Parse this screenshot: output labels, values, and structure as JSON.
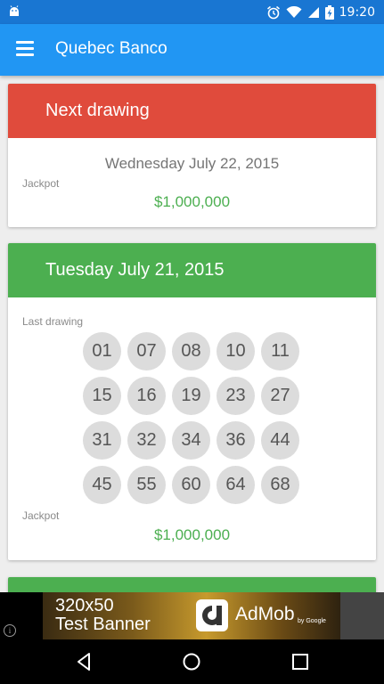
{
  "status_bar": {
    "time": "19:20",
    "icons": [
      "android-debug-icon",
      "alarm-icon",
      "wifi-icon",
      "cell-signal-icon",
      "battery-charging-icon"
    ]
  },
  "app_bar": {
    "title": "Quebec Banco",
    "menu_icon": "hamburger-menu-icon",
    "color": "#2196f3"
  },
  "next_drawing": {
    "header": "Next drawing",
    "header_color": "#e04b3c",
    "date": "Wednesday July 22, 2015",
    "jackpot_label": "Jackpot",
    "jackpot_value": "$1,000,000"
  },
  "last_drawing": {
    "header": "Tuesday July 21, 2015",
    "header_color": "#4caf50",
    "label": "Last drawing",
    "numbers": [
      "01",
      "07",
      "08",
      "10",
      "11",
      "15",
      "16",
      "19",
      "23",
      "27",
      "31",
      "32",
      "34",
      "36",
      "44",
      "45",
      "55",
      "60",
      "64",
      "68"
    ],
    "jackpot_label": "Jackpot",
    "jackpot_value": "$1,000,000"
  },
  "ad_banner": {
    "line1": "320x50",
    "line2": "Test Banner",
    "brand": "AdMob",
    "by": "by Google",
    "info": "i"
  },
  "nav_bar": {
    "icons": [
      "back-icon",
      "home-icon",
      "recents-icon"
    ]
  }
}
